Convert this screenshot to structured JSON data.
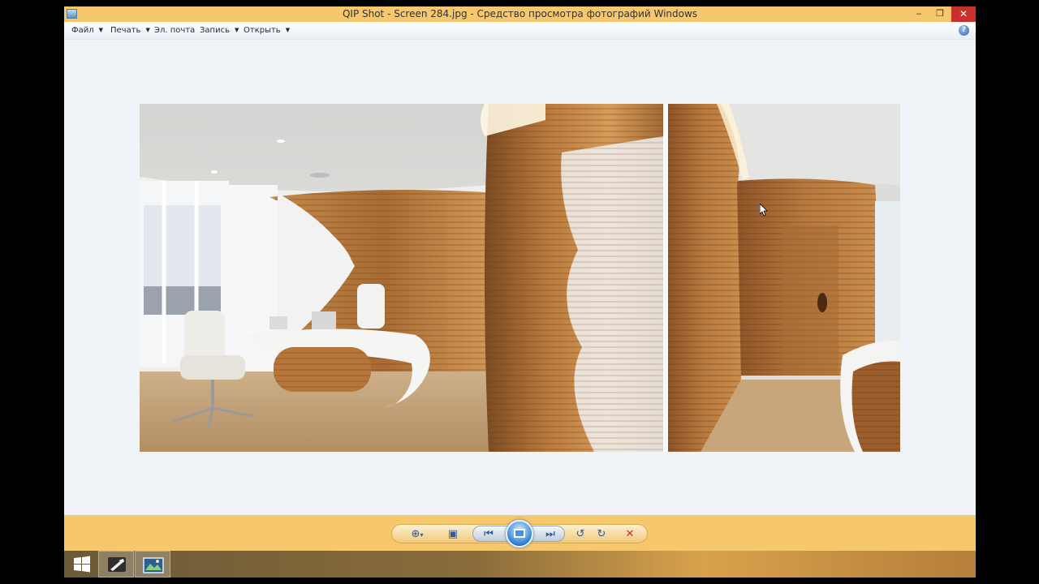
{
  "window": {
    "title": "QIP Shot - Screen 284.jpg - Средство просмотра фотографий Windows",
    "buttons": {
      "minimize": "‒",
      "maximize": "❐",
      "close": "✕"
    }
  },
  "menu": {
    "items": [
      {
        "label": "Файл",
        "has_dropdown": true
      },
      {
        "label": "Печать",
        "has_dropdown": true
      },
      {
        "label": "Эл. почта",
        "has_dropdown": false
      },
      {
        "label": "Запись",
        "has_dropdown": true
      },
      {
        "label": "Открыть",
        "has_dropdown": true
      }
    ],
    "help_label": "?"
  },
  "photo": {
    "description_icon": "office-interior-photo",
    "panels": [
      "office-with-wooden-wave-wall",
      "wooden-corridor-with-door"
    ]
  },
  "toolbar": {
    "zoom_icon": "magnifier-icon",
    "fit_icon": "actual-size-icon",
    "prev_icon": "previous-icon",
    "slideshow_icon": "slideshow-icon",
    "next_icon": "next-icon",
    "rotate_left_icon": "rotate-left-icon",
    "rotate_right_icon": "rotate-right-icon",
    "delete_icon": "delete-icon",
    "glyphs": {
      "zoom": "⊕",
      "fit": "▣",
      "prev": "⏮",
      "next": "⏭",
      "rotate_left": "↺",
      "rotate_right": "↻",
      "delete": "✕",
      "dropdown": "▾"
    }
  },
  "colors": {
    "titlebar": "#f6c76c",
    "close_button": "#c7302b",
    "viewer_background": "#f0f4f9",
    "accent_blue": "#2e7fd4"
  },
  "taskbar": {
    "items": [
      "start-button",
      "qip-shot-app",
      "photo-viewer-app"
    ]
  }
}
